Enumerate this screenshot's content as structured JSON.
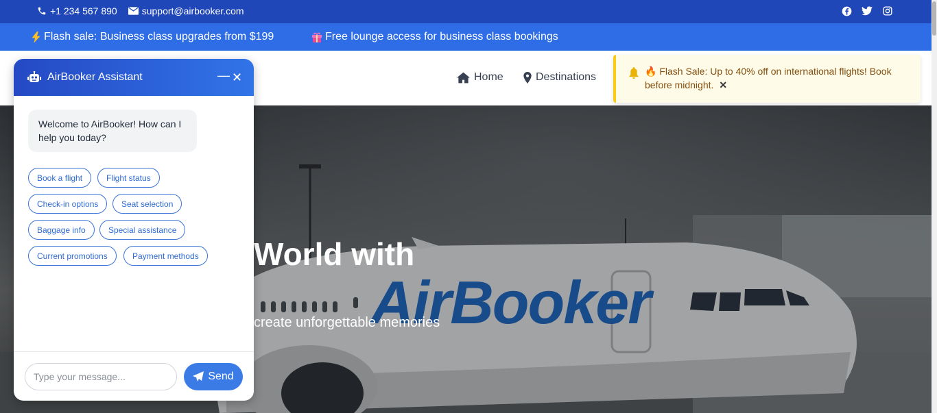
{
  "topbar": {
    "phone": "+1 234 567 890",
    "email": "support@airbooker.com",
    "social": [
      "facebook-icon",
      "twitter-icon",
      "instagram-icon"
    ]
  },
  "promo": {
    "item1": "Flash sale: Business class upgrades from $199",
    "item2": "Free lounge access for business class bookings"
  },
  "nav": {
    "home": "Home",
    "destinations": "Destinations"
  },
  "toast": {
    "message": "🔥 Flash Sale: Up to 40% off on international flights! Book before midnight.",
    "close": "✕"
  },
  "hero": {
    "title_visible": "World with",
    "subtitle_visible": "create unforgettable memories",
    "plane_brand": "AirBooker"
  },
  "chat": {
    "title": "AirBooker Assistant",
    "welcome": "Welcome to AirBooker! How can I help you today?",
    "chips": [
      "Book a flight",
      "Flight status",
      "Check-in options",
      "Seat selection",
      "Baggage info",
      "Special assistance",
      "Current promotions",
      "Payment methods"
    ],
    "input_placeholder": "Type your message...",
    "send_label": "Send"
  },
  "colors": {
    "topbar": "#1f47b8",
    "promo": "#2f6de6",
    "accent": "#3b7be6",
    "toast_bg": "#fefce8",
    "toast_border": "#facc15"
  }
}
